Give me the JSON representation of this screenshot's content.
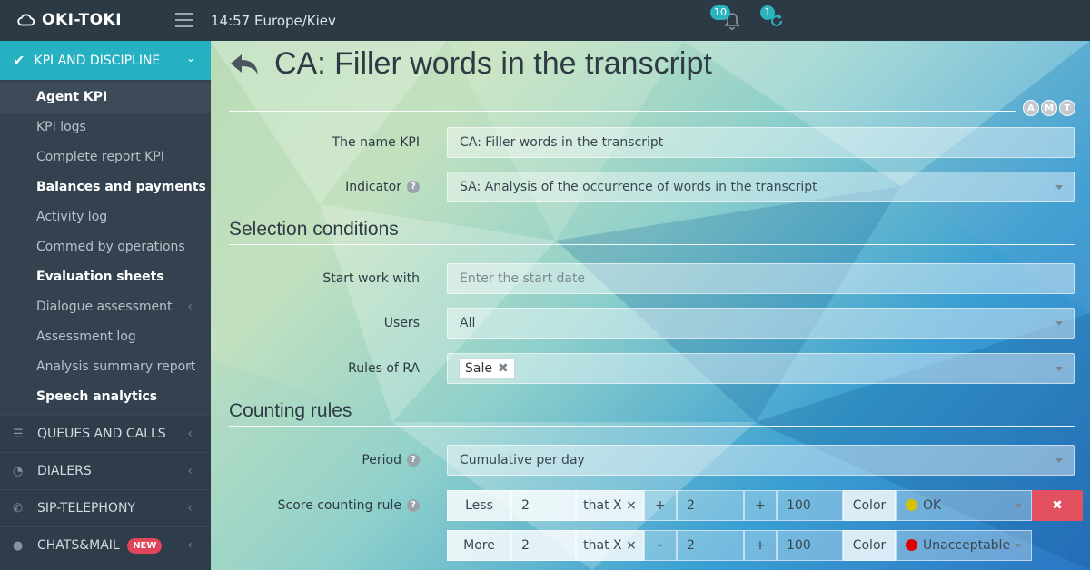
{
  "app": {
    "logo_text": "OKI-TOKI"
  },
  "topbar": {
    "clock": "14:57  Europe/Kiev",
    "notifications_count": "10",
    "sync_count": "1"
  },
  "sidebar": {
    "active_section": "KPI AND DISCIPLINE",
    "sub_items": [
      {
        "label": "Agent KPI"
      },
      {
        "label": "KPI logs"
      },
      {
        "label": "Complete report KPI"
      },
      {
        "label": "Balances and payments"
      },
      {
        "label": "Activity log"
      },
      {
        "label": "Commed by operations"
      },
      {
        "label": "Evaluation sheets"
      },
      {
        "label": "Dialogue assessment"
      },
      {
        "label": "Assessment log"
      },
      {
        "label": "Analysis summary report"
      },
      {
        "label": "Speech analytics"
      }
    ],
    "nav_items": [
      {
        "label": "QUEUES AND CALLS",
        "icon": "list-icon"
      },
      {
        "label": "DIALERS",
        "icon": "clock-icon"
      },
      {
        "label": "SIP-TELEPHONY",
        "icon": "phone-icon"
      },
      {
        "label": "CHATS&MAIL",
        "icon": "chat-icon",
        "badge": "NEW"
      }
    ]
  },
  "page": {
    "title": "CA: Filler words in the transcript",
    "view_toggles": [
      "A",
      "M",
      "T"
    ]
  },
  "form": {
    "name_label": "The name KPI",
    "name_value": "CA: Filler words in the transcript",
    "indicator_label": "Indicator",
    "indicator_value": "SA: Analysis of the occurrence of words in the transcript",
    "selection_title": "Selection conditions",
    "start_label": "Start work with",
    "start_placeholder": "Enter the start date",
    "users_label": "Users",
    "users_value": "All",
    "rules_label": "Rules of RA",
    "rules_tag": "Sale",
    "counting_title": "Counting rules",
    "period_label": "Period",
    "period_value": "Cumulative per day",
    "score_label": "Score counting rule",
    "rules": [
      {
        "cmp": "Less",
        "a": "2",
        "mult": "that X ×",
        "op1": "+",
        "b": "2",
        "op2": "+",
        "c": "100",
        "color_label": "Color",
        "status": "OK",
        "status_color": "#d4c200"
      },
      {
        "cmp": "More",
        "a": "2",
        "mult": "that X ×",
        "op1": "-",
        "b": "2",
        "op2": "+",
        "c": "100",
        "color_label": "Color",
        "status": "Unacceptable",
        "status_color": "#e00000"
      }
    ]
  },
  "colors": {
    "accent": "#26b1c3",
    "sidebar_bg": "#2f3d4a",
    "topbar_bg": "#2c3a46",
    "danger": "#e35060"
  }
}
